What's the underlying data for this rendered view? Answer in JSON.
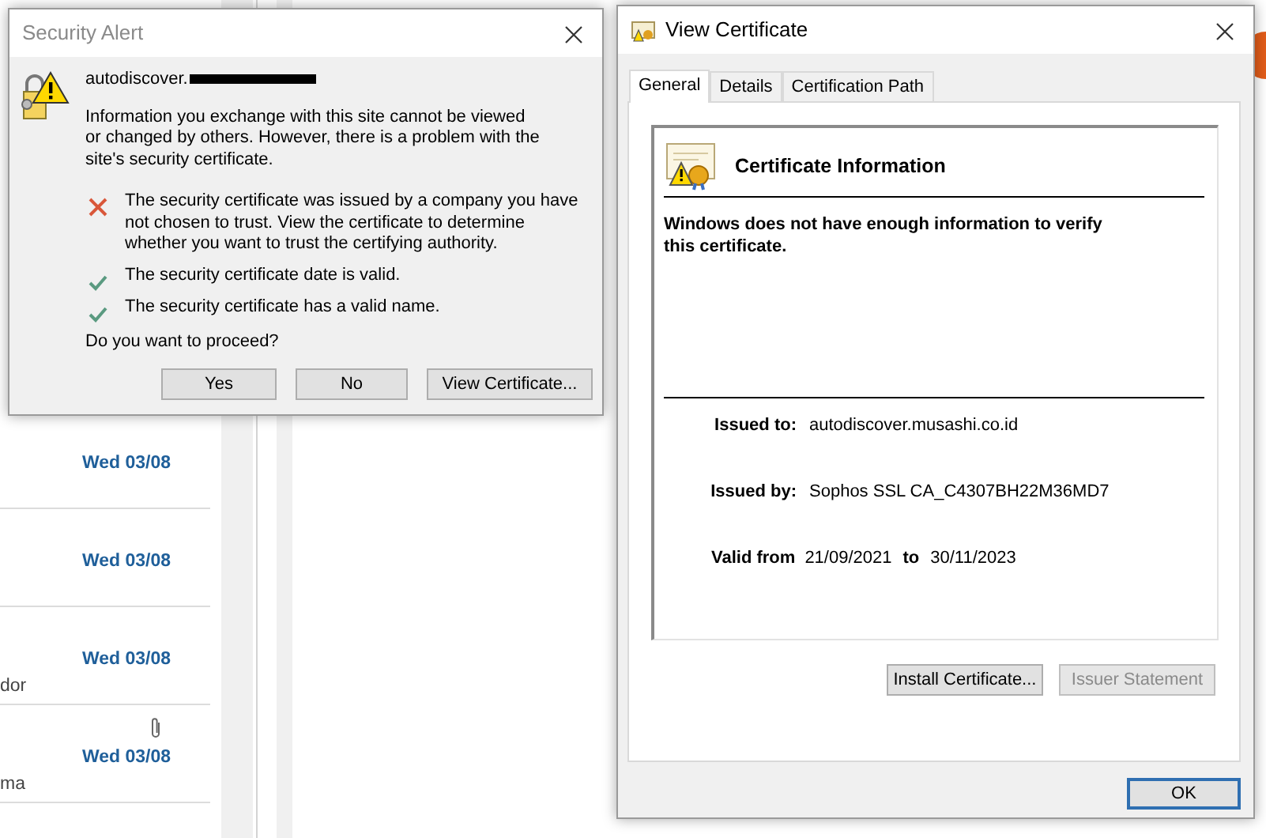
{
  "background": {
    "messages": [
      {
        "date": "Wed 03/08",
        "attachment": false
      },
      {
        "date": "Wed 03/08",
        "attachment": false
      },
      {
        "date": "Wed 03/08",
        "snippet": "dor",
        "attachment": false
      },
      {
        "date": "Wed 03/08",
        "snippet": "ma",
        "attachment": true
      }
    ]
  },
  "security_alert": {
    "title": "Security Alert",
    "host": "autodiscover.",
    "host_redacted": true,
    "message": "Information you exchange with this site cannot be viewed or changed by others. However, there is a problem with the site's security certificate.",
    "checks": [
      {
        "kind": "error",
        "text": "The security certificate was issued by a company you have not chosen to trust. View the certificate to determine whether you want to trust the certifying authority."
      },
      {
        "kind": "ok",
        "text": "The security certificate date is valid."
      },
      {
        "kind": "ok",
        "text": "The security certificate has a valid name."
      }
    ],
    "question": "Do you want to proceed?",
    "buttons": [
      "Yes",
      "No",
      "View Certificate..."
    ]
  },
  "certificate_window": {
    "title": "View Certificate",
    "tabs": [
      {
        "label": "General",
        "selected": true
      },
      {
        "label": "Details",
        "selected": false
      },
      {
        "label": "Certification Path",
        "selected": false
      }
    ],
    "heading": "Certificate Information",
    "warning": "Windows does not have enough information to verify this certificate.",
    "fields": [
      {
        "label": "Issued to:",
        "value": "autodiscover.musashi.co.id"
      },
      {
        "label": "Issued by:",
        "value": "Sophos SSL CA_C4307BH22M36MD7"
      }
    ],
    "validity": {
      "label": "Valid from",
      "from": "21/09/2021",
      "to_label": "to",
      "to": "30/11/2023"
    },
    "buttons": [
      {
        "label": "Install Certificate...",
        "disabled": false
      },
      {
        "label": "Issuer Statement",
        "disabled": true
      }
    ],
    "ok": "OK"
  }
}
